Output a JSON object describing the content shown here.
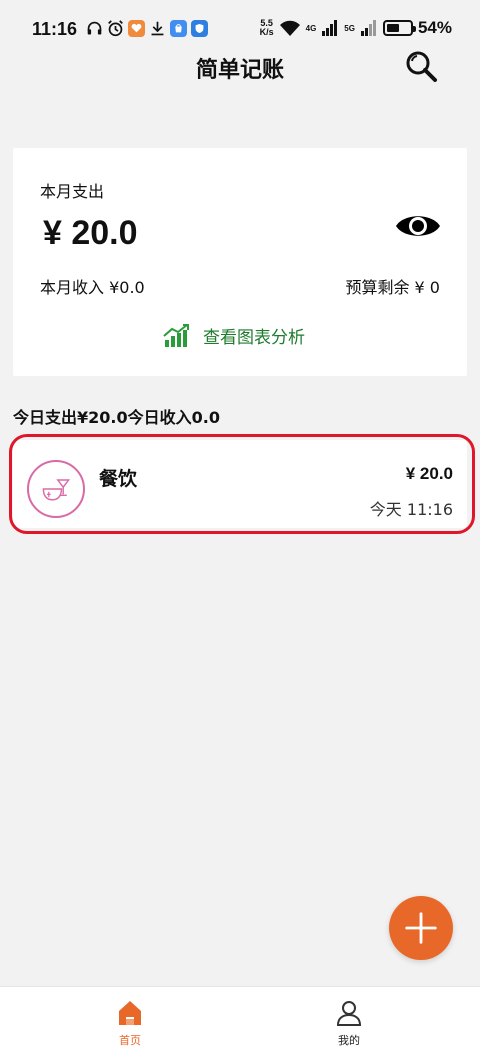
{
  "status_bar": {
    "time": "11:16",
    "net_speed_top": "5.5",
    "net_speed_bottom": "K/s",
    "signal_1": "4G",
    "signal_2": "5G",
    "battery_level": 0.54,
    "battery_text": "54%"
  },
  "header": {
    "title": "简单记账"
  },
  "summary": {
    "month_expense_label": "本月支出",
    "month_expense_value": "¥ 20.0",
    "month_income": "本月收入 ¥0.0",
    "budget_left": "预算剩余 ¥ 0",
    "chart_link_label": "查看图表分析"
  },
  "today": {
    "summary_text": "今日支出¥20.0今日收入0.0"
  },
  "records": [
    {
      "category": "餐饮",
      "amount": "¥ 20.0",
      "time": "今天 11:16"
    }
  ],
  "bottom_nav": {
    "home_label": "首页",
    "mine_label": "我的"
  },
  "colors": {
    "accent": "#e8682a",
    "chart_link": "#1e7b2e",
    "highlight_outline": "#e0162b",
    "category_pink": "#d96aa6"
  },
  "icons": [
    "headphones-icon",
    "alarm-icon",
    "app-badge-icon",
    "download-icon",
    "store-icon",
    "shield-app-icon",
    "wifi-icon",
    "signal-icon",
    "battery-icon",
    "search-icon",
    "eye-icon",
    "chart-trend-icon",
    "dining-icon",
    "plus-icon",
    "home-icon",
    "user-icon"
  ]
}
